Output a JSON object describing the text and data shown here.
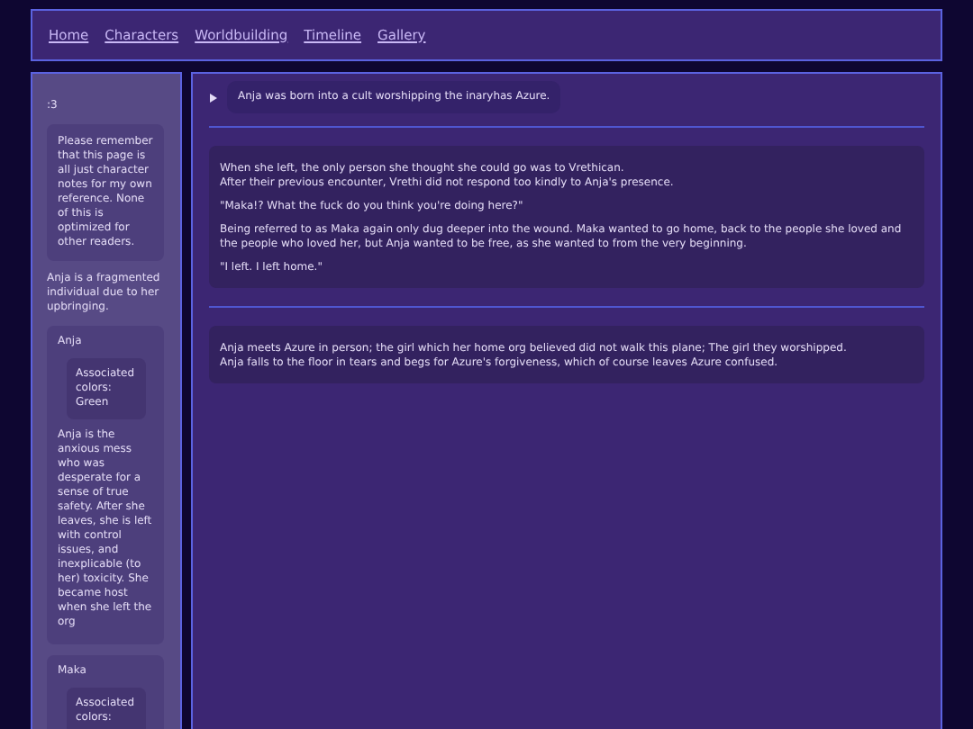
{
  "nav": {
    "links": [
      "Home",
      "Characters",
      "Worldbuilding",
      "Timeline",
      "Gallery"
    ]
  },
  "sidebar": {
    "heading": ":3",
    "notice": "Please remember that this page is all just character notes for my own reference. None of this is optimized for other readers.",
    "intro": "Anja is a fragmented individual due to her upbringing.",
    "characters": [
      {
        "name": "Anja",
        "colors": "Associated colors: Green",
        "description": "Anja is the anxious mess who was desperate for a sense of true safety. After she leaves, she is left with control issues, and inexplicable (to her) toxicity. She became host when she left the org"
      },
      {
        "name": "Maka",
        "colors": "Associated colors:"
      }
    ]
  },
  "main": {
    "summary": {
      "text": "Anja was born into a cult worshipping the inaryhas Azure.",
      "expanded": false
    },
    "sections": [
      {
        "paragraphs": [
          [
            "When she left, the only person she thought she could go was to Vrethican.",
            "After their previous encounter, Vrethi did not respond too kindly to Anja's presence."
          ],
          [
            "\"Maka!? What the fuck do you think you're doing here?\""
          ],
          [
            "Being referred to as Maka again only dug deeper into the wound. Maka wanted to go home, back to the people she loved and the people who loved her, but Anja wanted to be free, as she wanted to from the very beginning."
          ],
          [
            "\"I left. I left home.\""
          ]
        ]
      },
      {
        "paragraphs": [
          [
            "Anja meets Azure in person; the girl which her home org believed did not walk this plane; The girl they worshipped.",
            "Anja falls to the floor in tears and begs for Azure's forgiveness, which of course leaves Azure confused."
          ]
        ]
      }
    ]
  }
}
